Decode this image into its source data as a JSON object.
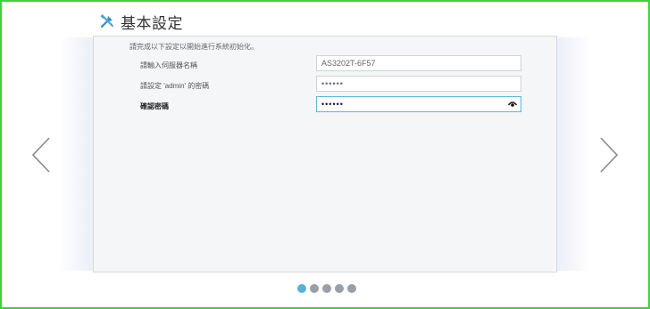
{
  "header": {
    "title": "基本設定",
    "icon": "tools-icon"
  },
  "form": {
    "intro": "請完成以下設定以開始進行系統初始化。",
    "server_name_label": "請輸入伺服器名稱",
    "server_name_value": "AS3202T-6F57",
    "admin_password_label": "請設定 'admin' 的密碼",
    "admin_password_value": "••••••",
    "confirm_password_label": "確認密碼",
    "confirm_password_value": "••••••"
  },
  "pager": {
    "total_pages": 5,
    "current_page": 1
  },
  "colors": {
    "accent": "#5bb2d6",
    "frame": "#3fd13a"
  }
}
